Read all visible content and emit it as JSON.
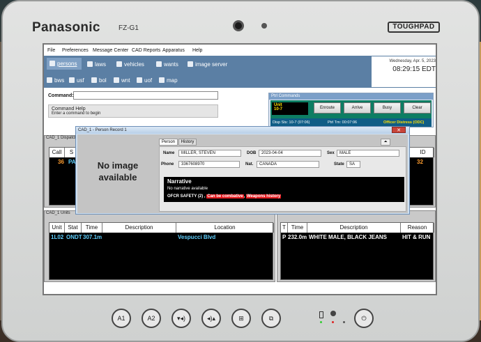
{
  "device": {
    "brand": "Panasonic",
    "model": "FZ-G1",
    "badge": "TOUGHPAD"
  },
  "menubar": {
    "items": [
      "File",
      "Preferences",
      "Message Center",
      "CAD Reports",
      "Apparatus",
      "Help"
    ]
  },
  "navbar": {
    "row1": [
      "persons",
      "laws",
      "vehicles",
      "wants",
      "image server"
    ],
    "row2": [
      "bws",
      "usf",
      "bol",
      "wnt",
      "uof",
      "map"
    ],
    "date": "Wednesday, Apr. 5, 2023",
    "time": "08:29:15 EDT"
  },
  "command": {
    "label": "Command:",
    "value": "",
    "help_title": "Command Help",
    "help_text": "Enter a command to begin"
  },
  "ptrl_commands": {
    "title": "Ptrl Commands",
    "unit_label": "Unit",
    "unit_code": "10-7",
    "buttons": [
      "Enroute",
      "Arrive",
      "Busy",
      "Clear"
    ],
    "disp_sts": "Disp Sts: 10-7 (07:06)",
    "ptrl_tm": "Ptrl Tm: 00:07:06",
    "officer_status": "Officer Distress (ODC)"
  },
  "dispatch_panel": {
    "title": "CAD_1 Dispatch",
    "headers": [
      "Call",
      "S"
    ],
    "row": [
      "36",
      "PA"
    ],
    "right_header": "ID",
    "right_value": "32"
  },
  "units_panel": {
    "title": "CAD_1 Units",
    "headers": [
      "Unit",
      "Stat",
      "Time",
      "Description",
      "Location"
    ],
    "row": [
      "1L02",
      "ONDT",
      "307.1m",
      "",
      "Vespucci Blvd"
    ]
  },
  "bolo_panel": {
    "headers": [
      "T",
      "Time",
      "Description",
      "Reason"
    ],
    "row": [
      "P",
      "232.0m",
      "WHITE MALE, BLACK JEANS",
      "HIT & RUN"
    ]
  },
  "person_record": {
    "title": "CAD_1 - Person Record 1",
    "close": "✕",
    "no_image": "No image available",
    "tabs": [
      "Person",
      "History"
    ],
    "collapse": "⏶",
    "name_label": "Name",
    "name": "MILLER, STEVEN",
    "dob_label": "DOB",
    "dob": "2023-04-04",
    "sex_label": "Sex",
    "sex": "MALE",
    "phone_label": "Phone",
    "phone": "3367608970",
    "nat_label": "Nat.",
    "nat": "CANADA",
    "state_label": "State",
    "state": "SA",
    "narrative_title": "Narrative",
    "narrative_text": "No narrative available",
    "safety_prefix": "OFCR SAFETY (2) ,",
    "safety_tags": [
      "Can be combative",
      "Weapons history"
    ],
    "safety_sep": ","
  },
  "hardware": {
    "buttons": [
      "A1",
      "A2",
      "▾◂)",
      "◂)▴",
      "⊞",
      "⧉",
      "⏻"
    ]
  },
  "colors": {
    "nav_blue": "#5b7fa4",
    "ptrl_green": "#0d7d63",
    "alert_red": "#e4181d",
    "unit_yellow": "#ffe000",
    "cyan_text": "#5fd0ff",
    "orange_text": "#ff9d2e"
  }
}
